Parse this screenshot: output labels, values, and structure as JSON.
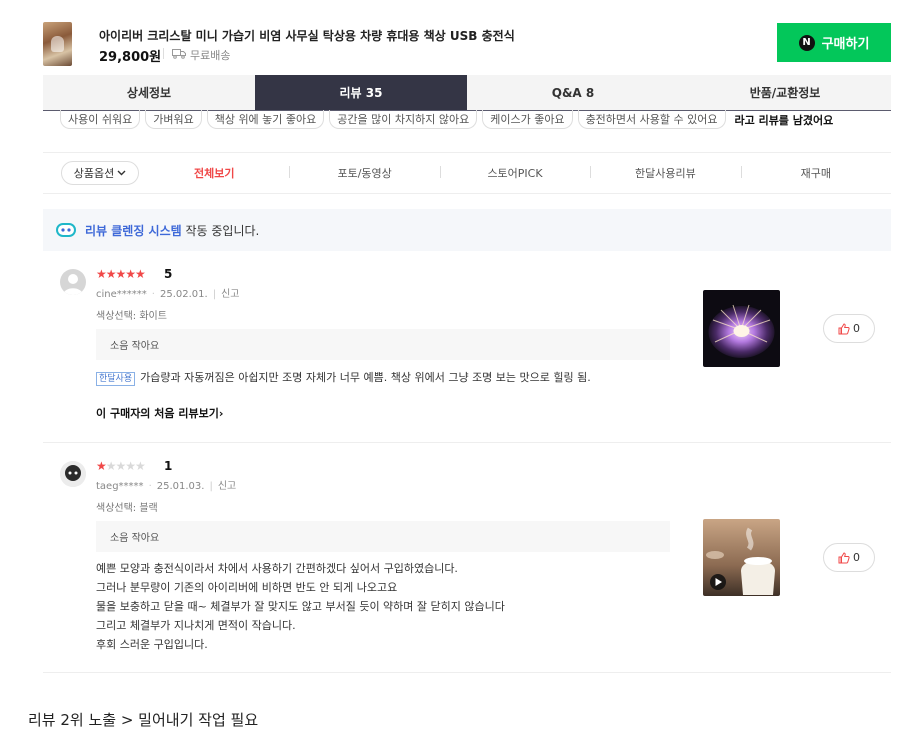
{
  "product": {
    "title": "아이리버 크리스탈 미니 가습기 비염 사무실 탁상용 차량 휴대용 책상 USB 충전식",
    "price": "29,800원",
    "shipping": "무료배송",
    "buy_button": "구매하기",
    "buy_badge": "N",
    "brand_color": "#03c75a"
  },
  "tabs": [
    {
      "label": "상세정보"
    },
    {
      "label": "리뷰 35",
      "active": true
    },
    {
      "label": "Q&A 8"
    },
    {
      "label": "반품/교환정보"
    }
  ],
  "keyword_chips": [
    "사용이 쉬워요",
    "가벼워요",
    "책상 위에 놓기 좋아요",
    "공간을 많이 차지하지 않아요",
    "케이스가 좋아요",
    "충전하면서 사용할 수 있어요"
  ],
  "keyword_cta": "라고 리뷰를 남겼어요",
  "filters": {
    "option_button": "상품옵션",
    "items": [
      "전체보기",
      "포토/동영상",
      "스토어PICK",
      "한달사용리뷰",
      "재구매"
    ],
    "active": "전체보기",
    "active_color": "#f04848"
  },
  "clean_system": {
    "highlight": "리뷰 클렌징 시스템",
    "rest": " 작동 중입니다."
  },
  "reviews": [
    {
      "rating": 5,
      "score_label": "5",
      "user": "cine******",
      "date": "25.02.01.",
      "report": "신고",
      "option": "색상선택: 화이트",
      "attribute": "소음 작아요",
      "tag": "한달사용",
      "body": "가습량과 자동꺼짐은 아쉽지만 조명 자체가 너무 예쁨. 책상 위에서 그냥 조명 보는 맛으로 힐링 됨.",
      "first_review_link": "이 구매자의 처음 리뷰보기",
      "likes": "0",
      "photo": "purple-lamp-photo"
    },
    {
      "rating": 1,
      "score_label": "1",
      "user": "taeg*****",
      "date": "25.01.03.",
      "report": "신고",
      "option": "색상선택: 블랙",
      "attribute": "소음 작아요",
      "lines": [
        "예쁜 모양과 충전식이라서 차에서 사용하기 간편하겠다 싶어서 구입하였습니다.",
        "그러나 분무량이 기존의 아이리버에 비하면 반도 안 되게 나오고요",
        "물을 보충하고 닫을 때~ 체결부가 잘 맞지도 않고 부서질 듯이 약하며 잘 닫히지 않습니다",
        "그리고 체결부가 지나치게 면적이 작습니다.",
        "후회 스러운 구입입니다."
      ],
      "likes": "0",
      "photo": "video-thumbnail"
    }
  ],
  "note": "리뷰 2위 노출 > 밀어내기 작업 필요"
}
